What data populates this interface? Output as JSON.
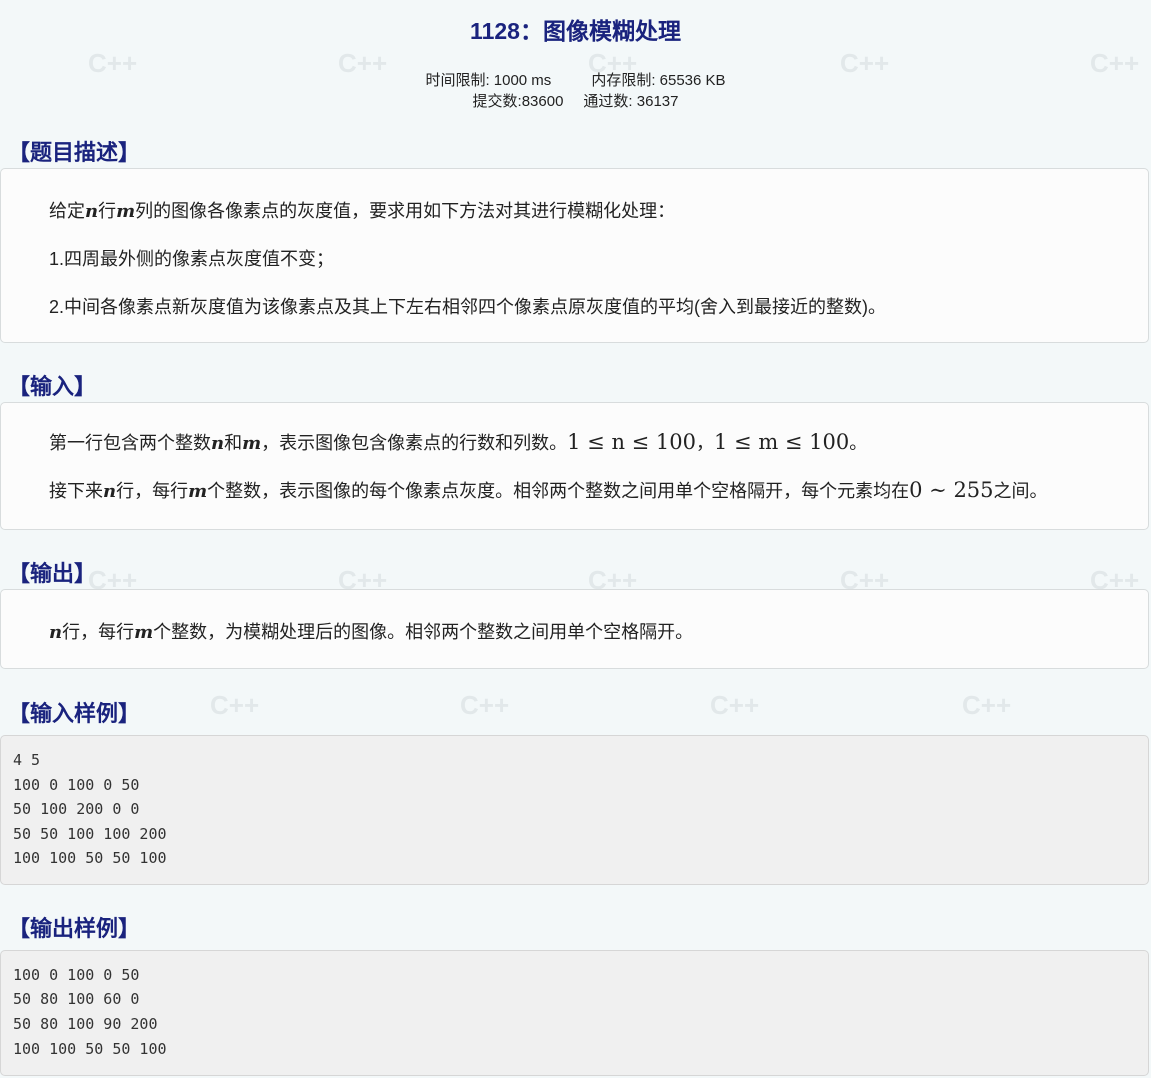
{
  "header": {
    "title": "1128：图像模糊处理",
    "time_limit": "时间限制: 1000 ms",
    "memory_limit": "内存限制: 65536 KB",
    "submissions": "提交数:83600",
    "accepted": "通过数: 36137"
  },
  "description": {
    "heading": "【题目描述】",
    "line1_a": "给定",
    "line1_n": "n",
    "line1_b": "行",
    "line1_m": "m",
    "line1_c": "列的图像各像素点的灰度值，要求用如下方法对其进行模糊化处理：",
    "line2": "1.四周最外侧的像素点灰度值不变；",
    "line3": "2.中间各像素点新灰度值为该像素点及其上下左右相邻四个像素点原灰度值的平均(舍入到最接近的整数)。"
  },
  "input": {
    "heading": "【输入】",
    "line1_a": "第一行包含两个整数",
    "line1_n": "n",
    "line1_b": "和",
    "line1_m": "m",
    "line1_c": "，表示图像包含像素点的行数和列数。",
    "line1_formula_a": "1 ≤ n ≤ 100",
    "line1_sep": "，",
    "line1_formula_b": "1 ≤ m ≤ 100",
    "line1_end": "。",
    "line2_a": "接下来",
    "line2_n": "n",
    "line2_b": "行，每行",
    "line2_m": "m",
    "line2_c": "个整数，表示图像的每个像素点灰度。相邻两个整数之间用单个空格隔开，每个元素均在",
    "line2_formula": "0 ∼ 255",
    "line2_end": "之间。"
  },
  "output": {
    "heading": "【输出】",
    "line1_n": "n",
    "line1_a": "行，每行",
    "line1_m": "m",
    "line1_b": "个整数，为模糊处理后的图像。相邻两个整数之间用单个空格隔开。"
  },
  "sample_input": {
    "heading": "【输入样例】",
    "lines": [
      "4 5",
      "100 0 100 0 50",
      "50 100 200 0 0",
      "50 50 100 100 200",
      "100 100 50 50 100"
    ]
  },
  "sample_output": {
    "heading": "【输出样例】",
    "lines": [
      "100 0 100 0 50",
      "50 80 100 60 0",
      "50 80 100 90 200",
      "100 100 50 50 100"
    ]
  },
  "colors": {
    "heading": "#1a237e",
    "background": "#f3f8f9",
    "panel": "#fcfcfc",
    "code_panel": "#f0f0f0"
  }
}
